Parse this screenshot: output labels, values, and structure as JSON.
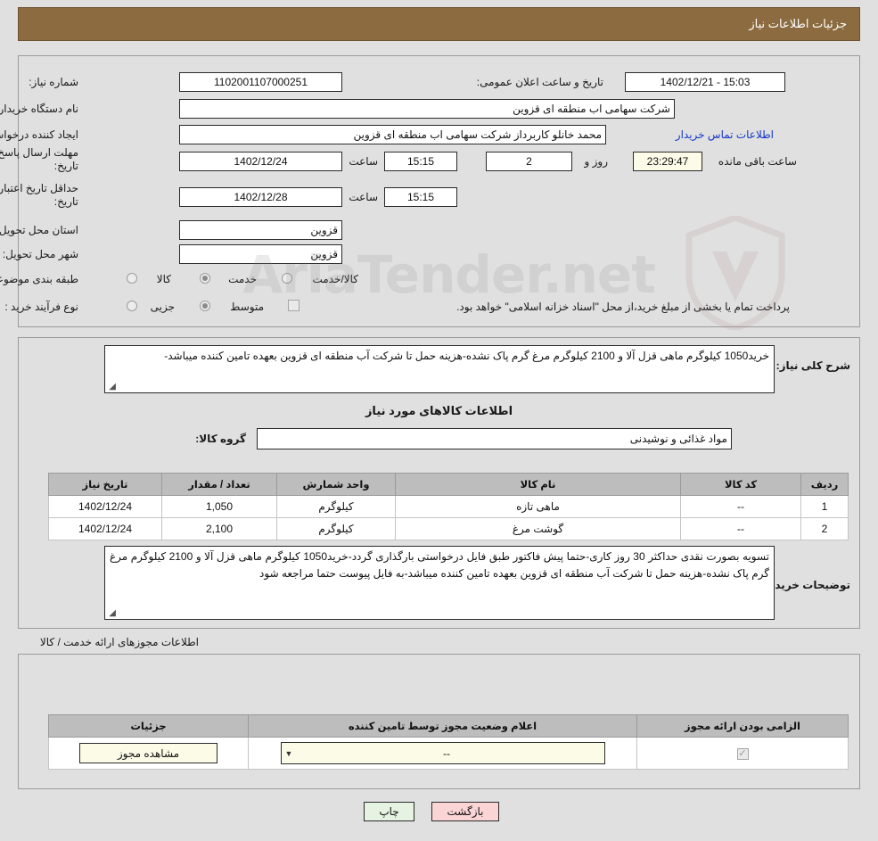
{
  "header": {
    "title": "جزئیات اطلاعات نیاز"
  },
  "main": {
    "labels": {
      "need_number": "شماره نیاز:",
      "buyer_org": "نام دستگاه خریدار:",
      "request_creator": "ایجاد کننده درخواست:",
      "reply_deadline": "مهلت ارسال پاسخ: تا تاریخ:",
      "price_validity": "حداقل تاریخ اعتبار قیمت: تا تاریخ:",
      "delivery_province": "استان محل تحویل:",
      "delivery_city": "شهر محل تحویل:",
      "subject_category": "طبقه بندی موضوعی:",
      "purchase_process": "نوع فرآیند خرید :",
      "public_announce": "تاریخ و ساعت اعلان عمومی:",
      "hour_1": "ساعت",
      "hour_2": "ساعت",
      "days_and": "روز و",
      "hours_remaining": "ساعت باقی مانده",
      "contact_link": "اطلاعات تماس خریدار"
    },
    "values": {
      "need_number": "1102001107000251",
      "buyer_org": "شرکت سهامی اب منطقه ای قزوین",
      "request_creator": "محمد خانلو کاربرداز شرکت سهامی اب منطقه ای قزوین",
      "reply_deadline_date": "1402/12/24",
      "reply_deadline_time": "15:15",
      "price_validity_date": "1402/12/28",
      "price_validity_time": "15:15",
      "delivery_province": "قزوین",
      "delivery_city": "قزوین",
      "public_announce": "15:03 - 1402/12/21",
      "days_left": "2",
      "time_left": "23:29:47"
    },
    "category_options": [
      {
        "label": "کالا",
        "selected": false
      },
      {
        "label": "خدمت",
        "selected": true
      },
      {
        "label": "کالا/خدمت",
        "selected": false
      }
    ],
    "process_options": [
      {
        "label": "جزیی",
        "selected": false
      },
      {
        "label": "متوسط",
        "selected": true
      }
    ],
    "treasury_checkbox": {
      "checked": false,
      "label": "پرداخت تمام یا بخشی از مبلغ خرید،از محل \"اسناد خزانه اسلامی\" خواهد بود."
    }
  },
  "description": {
    "label": "شرح کلی نیاز:",
    "text": "خرید1050 کیلوگرم ماهی قزل آلا و 2100 کیلوگرم مرغ گرم پاک نشده-هزینه حمل تا شرکت آب منطقه ای قزوین بعهده تامین کننده میباشد-"
  },
  "goods": {
    "section_title": "اطلاعات کالاهای مورد نیاز",
    "group_label": "گروه کالا:",
    "group_value": "مواد غذائی و نوشیدنی",
    "columns": [
      "ردیف",
      "کد کالا",
      "نام کالا",
      "واحد شمارش",
      "تعداد / مقدار",
      "تاریخ نیاز"
    ],
    "rows": [
      {
        "row": "1",
        "code": "--",
        "name": "ماهی تازه",
        "unit": "کیلوگرم",
        "qty": "1,050",
        "date": "1402/12/24"
      },
      {
        "row": "2",
        "code": "--",
        "name": "گوشت مرغ",
        "unit": "کیلوگرم",
        "qty": "2,100",
        "date": "1402/12/24"
      }
    ]
  },
  "buyer_notes": {
    "label": "توضیحات خریدار:",
    "text": "تسویه بصورت نقدی حداکثر 30 روز کاری-حتما پیش فاکتور طبق فایل درخواستی بارگذاری گردد-خرید1050 کیلوگرم ماهی قزل آلا و 2100 کیلوگرم مرغ گرم پاک نشده-هزینه حمل تا شرکت آب منطقه ای قزوین بعهده تامین کننده میباشد-به فایل پیوست حتما مراجعه شود"
  },
  "permits": {
    "section_title": "اطلاعات مجوزهای ارائه خدمت / کالا",
    "columns": [
      "الزامی بودن ارائه مجوز",
      "اعلام وضعیت مجوز توسط تامین کننده",
      "جزئیات"
    ],
    "rows": [
      {
        "required_checked": true,
        "status_value": "--",
        "detail_label": "مشاهده مجوز"
      }
    ]
  },
  "footer": {
    "print_label": "چاپ",
    "back_label": "بازگشت"
  },
  "watermark": {
    "text": "AriaTender.net"
  },
  "colors": {
    "header_bg": "#8b6b3f",
    "page_bg": "#e0e0e0",
    "link": "#1436c8",
    "print_btn": "#e6f3e2",
    "back_btn": "#fbd5d5",
    "cream": "#fbfbe8"
  }
}
